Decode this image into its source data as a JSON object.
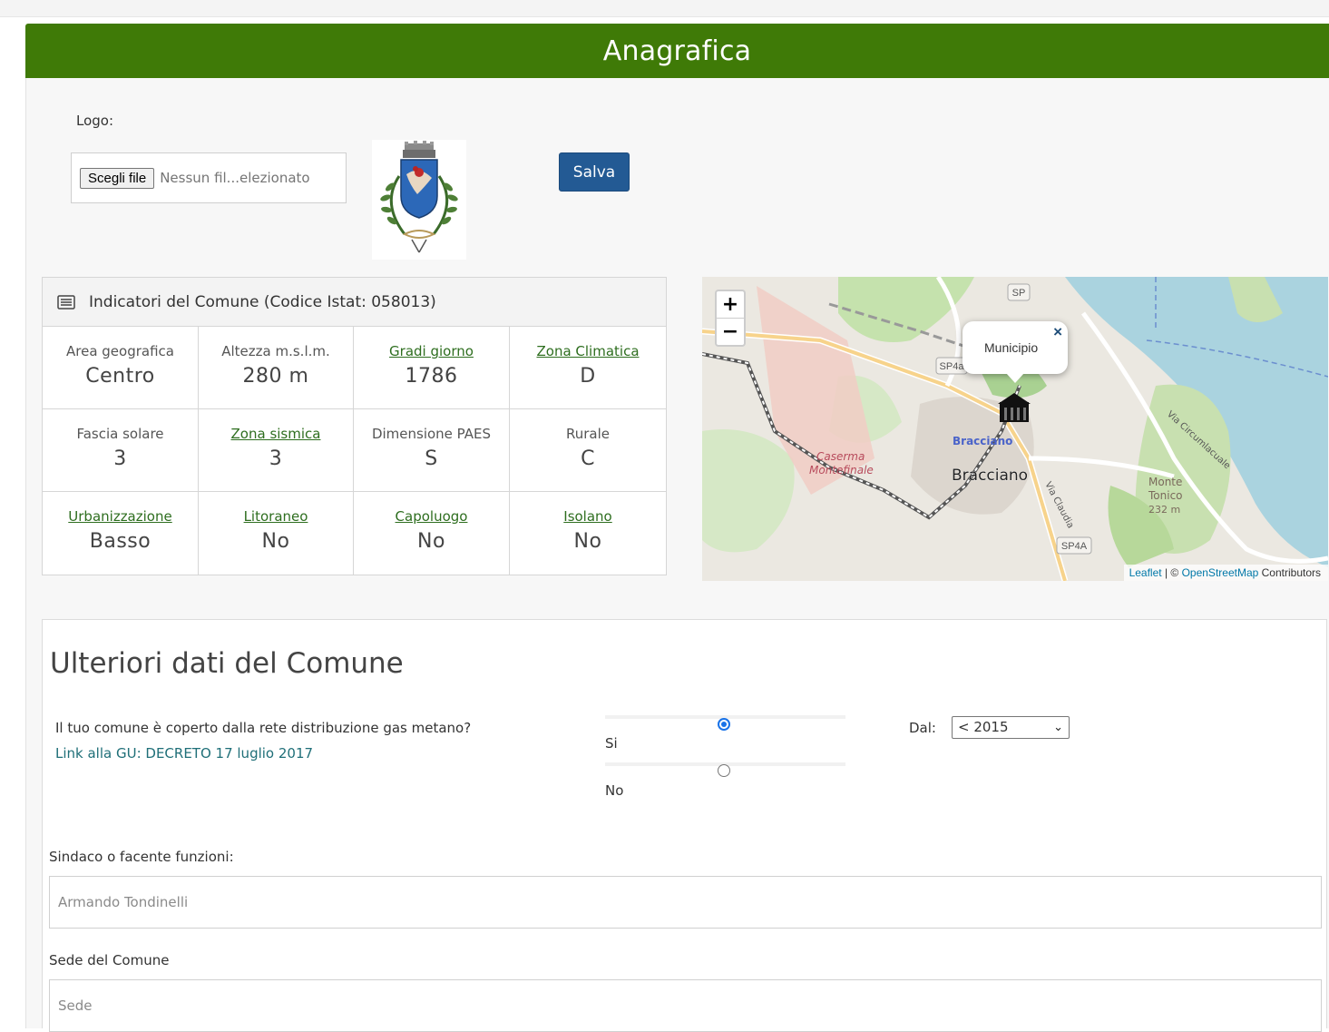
{
  "header": {
    "title": "Anagrafica"
  },
  "logo": {
    "label": "Logo:",
    "file_button": "Scegli file",
    "file_name": "Nessun fil...elezionato",
    "save_button": "Salva"
  },
  "indicators": {
    "title": "Indicatori del Comune (Codice Istat: 058013)",
    "cells": [
      {
        "label": "Area geografica",
        "value": "Centro",
        "link": false
      },
      {
        "label": "Altezza m.s.l.m.",
        "value": "280 m",
        "link": false
      },
      {
        "label": "Gradi giorno",
        "value": "1786",
        "link": true
      },
      {
        "label": "Zona Climatica",
        "value": "D",
        "link": true
      },
      {
        "label": "Fascia solare",
        "value": "3",
        "link": false
      },
      {
        "label": "Zona sismica",
        "value": "3",
        "link": true
      },
      {
        "label": "Dimensione PAES",
        "value": "S",
        "link": false
      },
      {
        "label": "Rurale",
        "value": "C",
        "link": false
      },
      {
        "label": "Urbanizzazione",
        "value": "Basso",
        "link": true
      },
      {
        "label": "Litoraneo",
        "value": "No",
        "link": true
      },
      {
        "label": "Capoluogo",
        "value": "No",
        "link": true
      },
      {
        "label": "Isolano",
        "value": "No",
        "link": true
      }
    ]
  },
  "map": {
    "zoom_in": "+",
    "zoom_out": "−",
    "popup_text": "Municipio",
    "popup_close": "×",
    "labels": {
      "sp": "SP",
      "sp4a_top": "SP4a",
      "sp4a_bottom": "SP4A",
      "bracciano_station": "Bracciano",
      "bracciano_town": "Bracciano",
      "caserma": "Caserma",
      "montefinale": "Montefinale",
      "via_claudia": "Via Claudia",
      "via_circumlacuale": "Via Circumlacuale",
      "monte": "Monte",
      "tonico": "Tonico",
      "altitude": "232 m"
    },
    "attribution_leaflet": "Leaflet",
    "attribution_sep": " | © ",
    "attribution_osm": "OpenStreetMap",
    "attribution_tail": " Contributors"
  },
  "further": {
    "title": "Ulteriori dati del Comune",
    "gas_question": "Il tuo comune è coperto dalla rete distribuzione gas metano?",
    "gas_link": "Link alla GU: DECRETO 17 luglio 2017",
    "option_yes": "Si",
    "option_no": "No",
    "selected_option": "Si",
    "dal_label": "Dal:",
    "dal_value": "< 2015",
    "sindaco_label": "Sindaco o facente funzioni:",
    "sindaco_value": "Armando Tondinelli",
    "sede_label": "Sede del Comune",
    "sede_placeholder": "Sede"
  },
  "colors": {
    "header_green": "#3f7a07",
    "save_blue": "#235a94",
    "link_green": "#2e6e1f",
    "link_teal": "#1f6f78",
    "radio_blue": "#1a73e8"
  }
}
